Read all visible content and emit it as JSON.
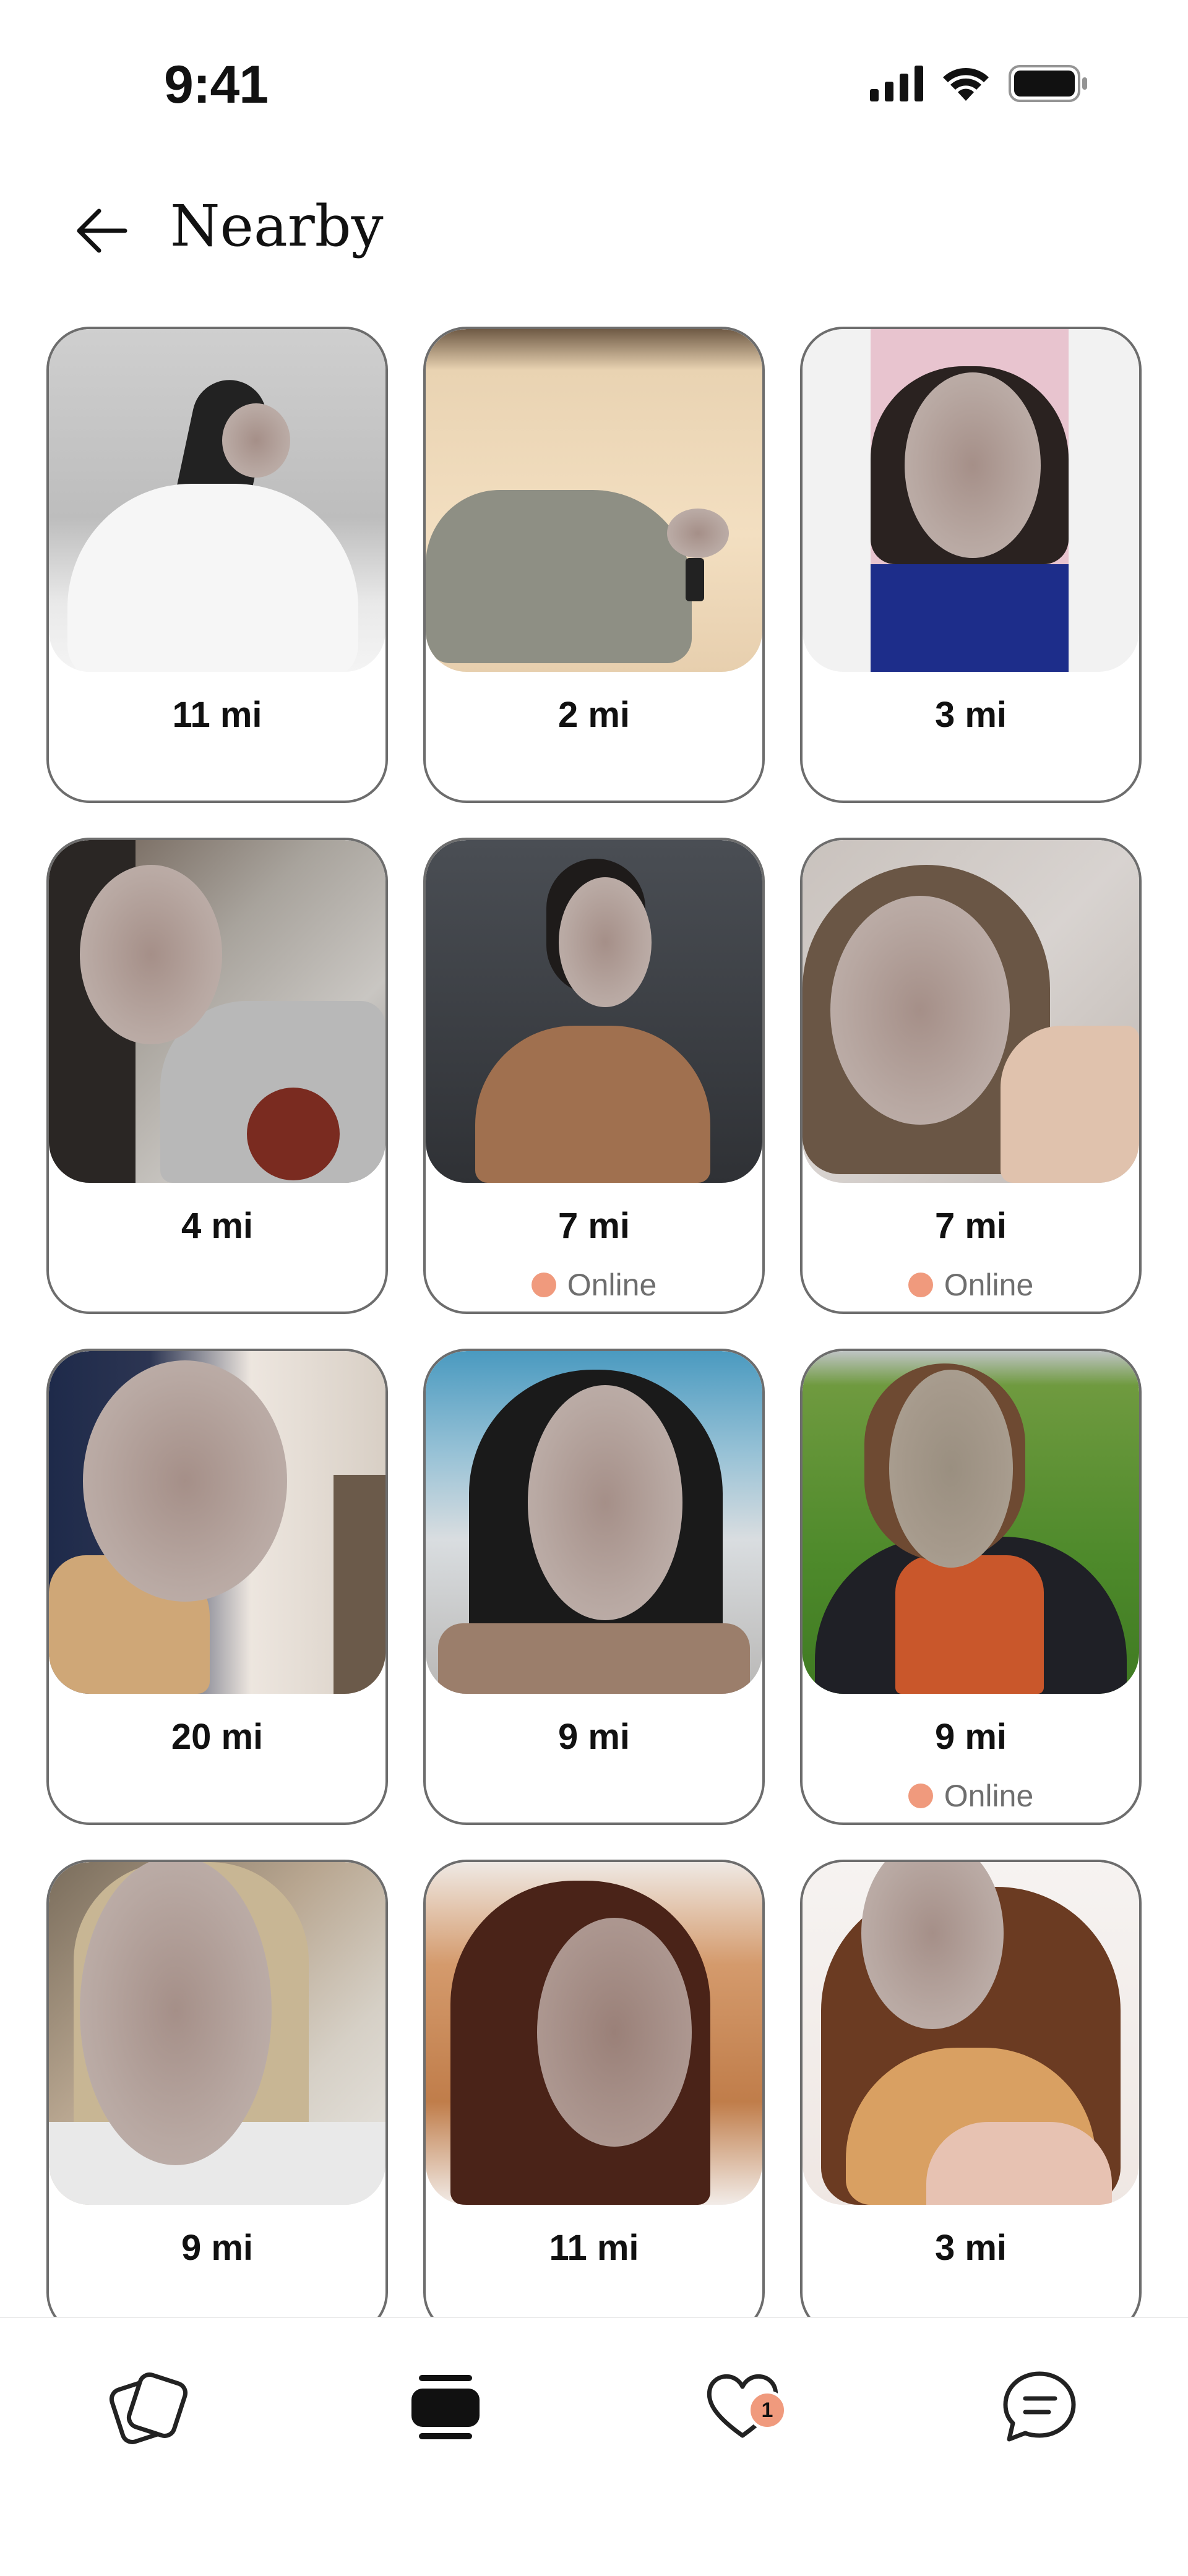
{
  "status_bar": {
    "time": "9:41"
  },
  "header": {
    "title": "Nearby"
  },
  "profiles": [
    {
      "distance": "11 mi",
      "online": ""
    },
    {
      "distance": "2 mi",
      "online": ""
    },
    {
      "distance": "3 mi",
      "online": ""
    },
    {
      "distance": "4 mi",
      "online": ""
    },
    {
      "distance": "7 mi",
      "online": "Online"
    },
    {
      "distance": "7 mi",
      "online": "Online"
    },
    {
      "distance": "20 mi",
      "online": ""
    },
    {
      "distance": "9 mi",
      "online": ""
    },
    {
      "distance": "9 mi",
      "online": "Online"
    },
    {
      "distance": "9 mi",
      "online": ""
    },
    {
      "distance": "11 mi",
      "online": ""
    },
    {
      "distance": "3 mi",
      "online": ""
    }
  ],
  "bottom_nav": {
    "items": [
      {
        "icon": "cards-stack-icon"
      },
      {
        "icon": "grid-nearby-icon"
      },
      {
        "icon": "heart-likes-icon",
        "badge": "1"
      },
      {
        "icon": "chat-bubble-icon"
      }
    ]
  },
  "colors": {
    "online_dot": "#f09a7d",
    "card_border": "#6d6d6d",
    "badge": "#f09a7d"
  }
}
